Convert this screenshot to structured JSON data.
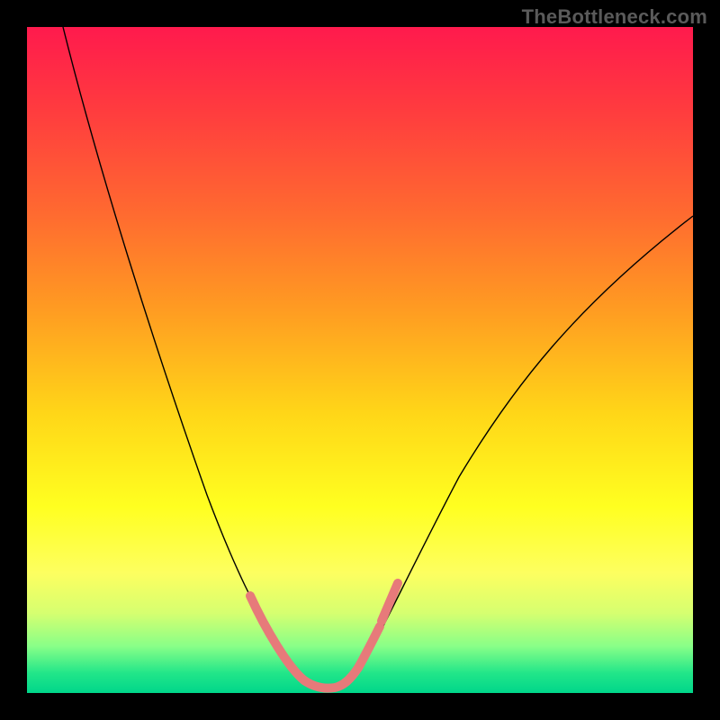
{
  "watermark": "TheBottleneck.com",
  "colors": {
    "gradient_top": "#ff1a4d",
    "gradient_mid": "#ffff20",
    "gradient_bottom": "#00d68a",
    "curve": "#000000",
    "highlight": "#e77a7a",
    "background": "#000000"
  },
  "chart_data": {
    "type": "line",
    "title": "",
    "xlabel": "",
    "ylabel": "",
    "xlim": [
      0,
      100
    ],
    "ylim": [
      0,
      100
    ],
    "grid": false,
    "legend": false,
    "series": [
      {
        "name": "bottleneck-curve",
        "x": [
          5,
          10,
          15,
          20,
          25,
          28,
          31,
          34,
          36,
          38,
          40,
          42,
          44,
          46,
          50,
          55,
          60,
          65,
          70,
          75,
          80,
          85,
          90,
          95,
          100
        ],
        "y": [
          100,
          82,
          65,
          50,
          36,
          28,
          20,
          13,
          9,
          5,
          3,
          2,
          2,
          3,
          6,
          12,
          20,
          28,
          36,
          44,
          51,
          58,
          64,
          69,
          73
        ]
      }
    ],
    "annotations": [
      {
        "name": "optimal-range-highlight",
        "x_range": [
          34,
          50
        ],
        "y_range": [
          2,
          13
        ]
      }
    ]
  }
}
